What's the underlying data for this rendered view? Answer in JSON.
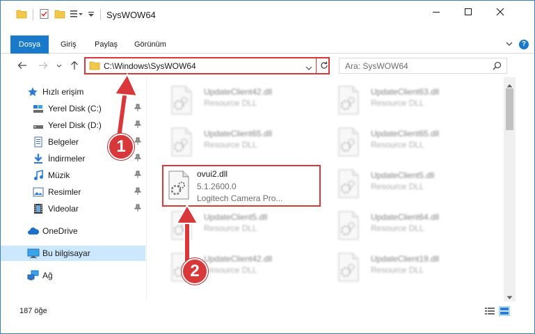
{
  "window": {
    "title": "SysWOW64",
    "accent_color": "#1979ca",
    "annotation_color": "#d9383a"
  },
  "ribbon": {
    "tabs": [
      "Dosya",
      "Giriş",
      "Paylaş",
      "Görünüm"
    ],
    "help_label": "?"
  },
  "address": {
    "path": "C:\\Windows\\SysWOW64",
    "search_placeholder": "Ara: SysWOW64"
  },
  "navigation": {
    "quick_access": "Hızlı erişim",
    "items": [
      {
        "label": "Yerel Disk (C:)",
        "icon": "drive-icon",
        "pinned": true
      },
      {
        "label": "Yerel Disk (D:)",
        "icon": "drive-icon",
        "pinned": true
      },
      {
        "label": "Belgeler",
        "icon": "documents-icon",
        "pinned": true
      },
      {
        "label": "İndirmeler",
        "icon": "downloads-icon",
        "pinned": true
      },
      {
        "label": "Müzik",
        "icon": "music-icon",
        "pinned": true
      },
      {
        "label": "Resimler",
        "icon": "pictures-icon",
        "pinned": true
      },
      {
        "label": "Videolar",
        "icon": "videos-icon",
        "pinned": true
      }
    ],
    "onedrive": "OneDrive",
    "this_pc": "Bu bilgisayar",
    "network": "Ağ"
  },
  "files": {
    "highlighted": {
      "name": "ovui2.dll",
      "version": "5.1.2600.0",
      "description": "Logitech Camera Pro..."
    },
    "blurred": [
      {
        "name": "UpdateClient42.dll",
        "type": "Resource DLL"
      },
      {
        "name": "UpdateClient63.dll",
        "type": "Resource DLL"
      },
      {
        "name": "UpdateClient65.dll",
        "type": "Resource DLL"
      },
      {
        "name": "UpdateClient65.dll",
        "type": "Resource DLL"
      },
      {
        "name": "UpdateClient5.dll",
        "type": "Resource DLL"
      },
      {
        "name": "UpdateClient5.dll",
        "type": "Resource DLL"
      },
      {
        "name": "UpdateClient64.dll",
        "type": "Resource DLL"
      },
      {
        "name": "UpdateClient42.dll",
        "type": "Resource DLL"
      },
      {
        "name": "UpdateClient19.dll",
        "type": "Resource DLL"
      }
    ]
  },
  "status": {
    "item_count": "187 öğe"
  },
  "annotations": {
    "step1": "1",
    "step2": "2"
  }
}
